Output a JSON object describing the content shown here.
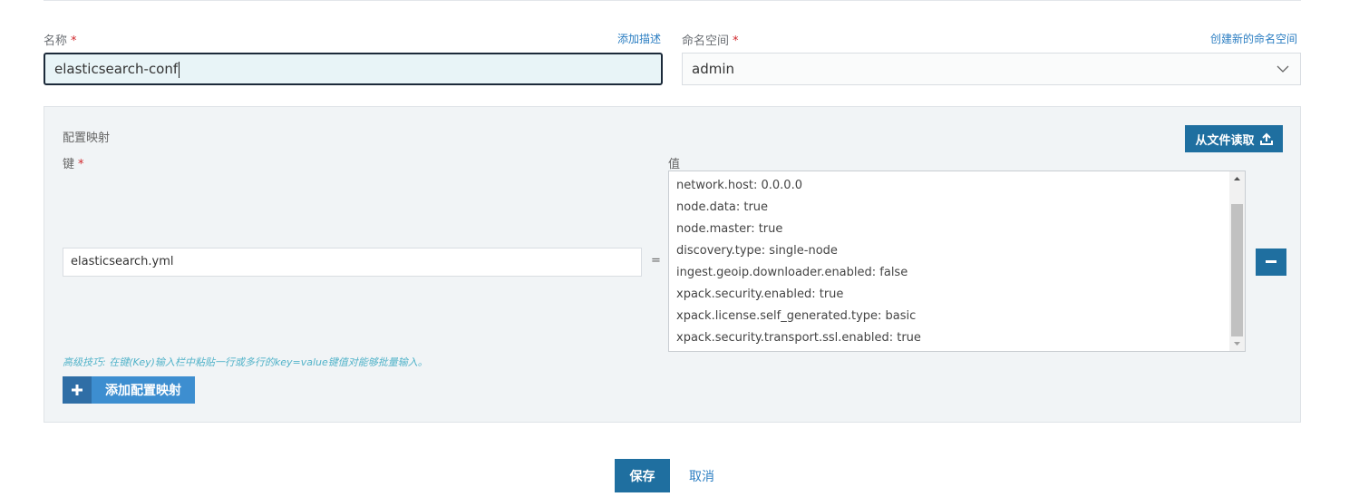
{
  "form": {
    "name_label": "名称",
    "required_mark": "*",
    "add_description": "添加描述",
    "name_value": "elasticsearch-conf",
    "namespace_label": "命名空间",
    "create_namespace": "创建新的命名空间",
    "namespace_value": "admin"
  },
  "config_map": {
    "title": "配置映射",
    "read_from_file": "从文件读取",
    "key_label": "键",
    "value_label": "值",
    "key_value": "elasticsearch.yml",
    "equals": "=",
    "value_lines": [
      "network.host: 0.0.0.0",
      "node.data: true",
      "node.master: true",
      "discovery.type: single-node",
      "ingest.geoip.downloader.enabled: false",
      "xpack.security.enabled: true",
      "xpack.license.self_generated.type: basic",
      "xpack.security.transport.ssl.enabled: true"
    ],
    "tip": "高级技巧: 在键(Key)输入栏中粘贴一行或多行的key=value键值对能够批量输入。",
    "add_mapping": "添加配置映射"
  },
  "actions": {
    "save": "保存",
    "cancel": "取消"
  },
  "colors": {
    "primary": "#1f6fa0",
    "link": "#2b7ec2",
    "required": "#d0262b"
  }
}
